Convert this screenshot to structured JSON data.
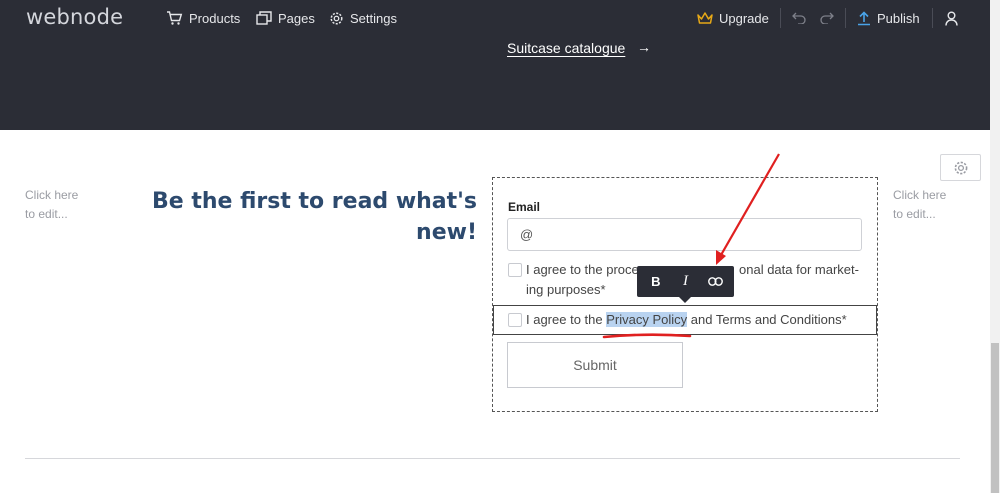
{
  "topbar": {
    "logo": "webnode",
    "nav": {
      "products": "Products",
      "pages": "Pages",
      "settings": "Settings"
    },
    "upgrade": "Upgrade",
    "publish": "Publish"
  },
  "hero": {
    "link_text": "Suitcase catalogue",
    "arrow": "→"
  },
  "content": {
    "click_here_left": "Click here",
    "to_edit_left": "to edit...",
    "click_here_right": "Click here",
    "to_edit_right": "to edit...",
    "heading_line1": "Be the first to read what's",
    "heading_line2": "new!"
  },
  "form": {
    "email_label": "Email",
    "email_value": "@",
    "consent_marketing_line1_a": "I agree to the proce",
    "consent_marketing_line1_b": "onal data for market-",
    "consent_marketing_line2": "ing purposes*",
    "consent_policy_prefix": "I agree to the ",
    "consent_policy_link": "Privacy Policy",
    "consent_policy_suffix": " and Terms and Conditions*",
    "submit_label": "Submit"
  },
  "format_toolbar": {
    "bold": "B",
    "italic": "I"
  },
  "colors": {
    "topbar_bg": "#2b2d36",
    "heading": "#2d4a6e",
    "upgrade_crown": "#e6a817",
    "publish_icon": "#4aa3e8",
    "annotation_red": "#e02020",
    "selection_highlight": "#b9d3f0"
  },
  "icons": [
    "cart-icon",
    "pages-icon",
    "gear-icon",
    "crown-icon",
    "undo-icon",
    "redo-icon",
    "upload-icon",
    "user-icon",
    "link-icon"
  ]
}
